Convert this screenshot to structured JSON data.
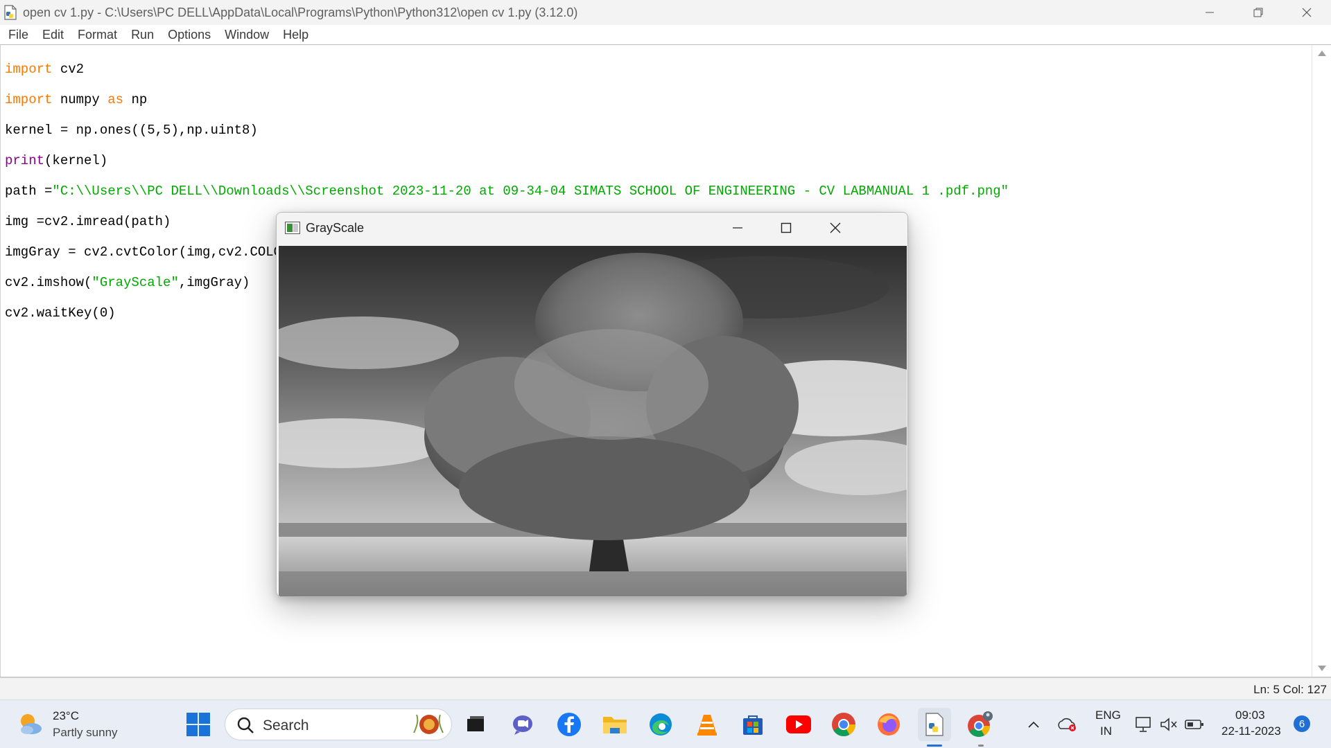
{
  "window": {
    "title": "open cv 1.py - C:\\Users\\PC DELL\\AppData\\Local\\Programs\\Python\\Python312\\open cv 1.py (3.12.0)"
  },
  "menu": [
    "File",
    "Edit",
    "Format",
    "Run",
    "Options",
    "Window",
    "Help"
  ],
  "code": {
    "l1_kw": "import",
    "l1_rest": " cv2",
    "l2_kw": "import",
    "l2_mid": " numpy ",
    "l2_kw2": "as",
    "l2_rest": " np",
    "l3": "kernel = np.ones((5,5),np.uint8)",
    "l4_bi": "print",
    "l4_rest": "(kernel)",
    "l5_pre": "path =",
    "l5_str": "\"C:\\\\Users\\\\PC DELL\\\\Downloads\\\\Screenshot 2023-11-20 at 09-34-04 SIMATS SCHOOL OF ENGINEERING - CV LABMANUAL 1 .pdf.png\"",
    "l6": "img =cv2.imread(path)",
    "l7": "imgGray = cv2.cvtColor(img,cv2.COLOR_BGR2GRAY)",
    "l8_pre": "cv2.imshow(",
    "l8_str": "\"GrayScale\"",
    "l8_rest": ",imgGray)",
    "l9": "cv2.waitKey(0)"
  },
  "status": {
    "position": "Ln: 5   Col: 127"
  },
  "grayscale_window": {
    "title": "GrayScale"
  },
  "taskbar": {
    "weather": {
      "temp": "23°C",
      "condition": "Partly sunny"
    },
    "search_label": "Search",
    "language_top": "ENG",
    "language_bottom": "IN",
    "time": "09:03",
    "date": "22-11-2023",
    "notification_count": "6",
    "pinned_icons": [
      "windows-start-icon",
      "file-manager-icon",
      "teams-chat-icon",
      "facebook-icon",
      "file-explorer-icon",
      "edge-icon",
      "vlc-icon",
      "microsoft-store-icon",
      "youtube-icon",
      "chrome-icon",
      "firefox-icon",
      "python-idle-icon",
      "chrome-profile-icon"
    ]
  }
}
